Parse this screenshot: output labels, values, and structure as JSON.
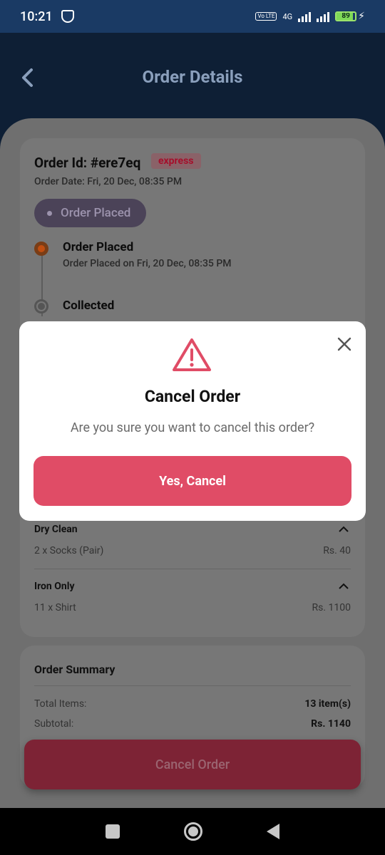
{
  "status_bar": {
    "time": "10:21",
    "network": "4G",
    "volte": "Vo LTE",
    "battery": "89"
  },
  "header": {
    "title": "Order Details"
  },
  "order": {
    "id_label": "Order Id: #ere7eq",
    "badge": "express",
    "date": "Order Date: Fri, 20 Dec, 08:35 PM",
    "status_pill": "Order Placed",
    "timeline": [
      {
        "title": "Order Placed",
        "subtitle": "Order Placed on Fri, 20 Dec, 08:35 PM"
      },
      {
        "title": "Collected"
      }
    ]
  },
  "services": [
    {
      "name": "Dry Clean",
      "items": [
        {
          "label": "2 x Socks (Pair)",
          "price": "Rs. 40"
        }
      ]
    },
    {
      "name": "Iron Only",
      "items": [
        {
          "label": "11 x Shirt",
          "price": "Rs. 1100"
        }
      ]
    }
  ],
  "summary": {
    "title": "Order Summary",
    "rows": [
      {
        "label": "Total Items:",
        "value": "13 item(s)"
      },
      {
        "label": "Subtotal:",
        "value": "Rs. 1140"
      }
    ]
  },
  "cancel_order_label": "Cancel Order",
  "modal": {
    "title": "Cancel Order",
    "message": "Are you sure you want to cancel this order?",
    "confirm_label": "Yes, Cancel"
  },
  "colors": {
    "accent": "#e04c66",
    "header": "#0e1f35",
    "status_bar": "#1a3a64"
  }
}
